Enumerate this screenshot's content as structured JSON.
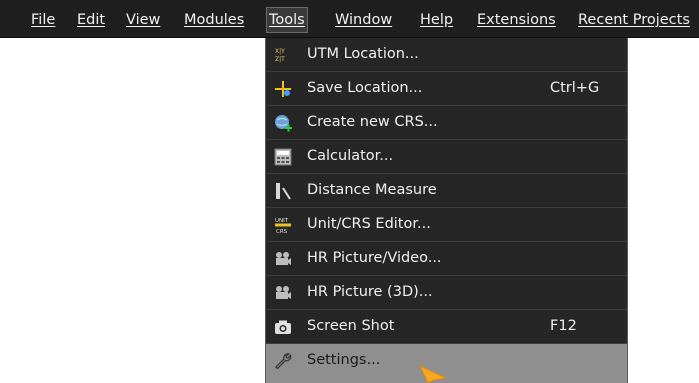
{
  "menubar": {
    "items": [
      {
        "label": "File"
      },
      {
        "label": "Edit"
      },
      {
        "label": "View"
      },
      {
        "label": "Modules"
      },
      {
        "label": "Tools"
      },
      {
        "label": "Window"
      },
      {
        "label": "Help"
      },
      {
        "label": "Extensions"
      },
      {
        "label": "Recent Projects"
      }
    ]
  },
  "tools_menu": {
    "items": [
      {
        "label": "UTM Location...",
        "shortcut": "",
        "icon": "utm-location-icon"
      },
      {
        "label": "Save Location...",
        "shortcut": "Ctrl+G",
        "icon": "save-location-icon"
      },
      {
        "label": "Create new CRS...",
        "shortcut": "",
        "icon": "create-crs-icon"
      },
      {
        "label": "Calculator...",
        "shortcut": "",
        "icon": "calculator-icon"
      },
      {
        "label": "Distance Measure",
        "shortcut": "",
        "icon": "distance-measure-icon"
      },
      {
        "label": "Unit/CRS Editor...",
        "shortcut": "",
        "icon": "unit-crs-editor-icon"
      },
      {
        "label": "HR Picture/Video...",
        "shortcut": "",
        "icon": "video-camera-icon"
      },
      {
        "label": "HR Picture (3D)...",
        "shortcut": "",
        "icon": "video-camera-icon"
      },
      {
        "label": "Screen Shot",
        "shortcut": "F12",
        "icon": "camera-icon"
      },
      {
        "label": "Settings...",
        "shortcut": "",
        "icon": "wrench-icon",
        "highlighted": true
      }
    ]
  },
  "colors": {
    "menubar_bg": "#1f1f1f",
    "menu_bg": "#262626",
    "highlight_bg": "#8f8f8f",
    "cursor": "#f5a623"
  }
}
